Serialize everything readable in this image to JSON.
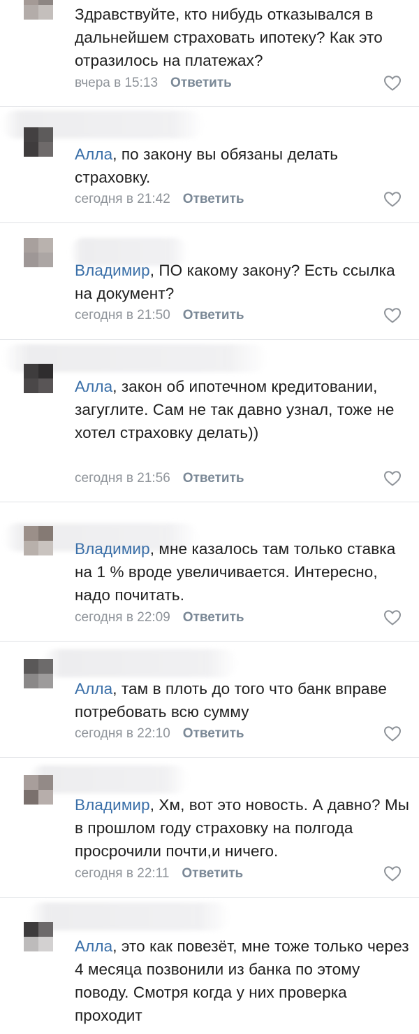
{
  "comments": [
    {
      "mention": "",
      "text": "Здравствуйте, кто нибудь отказывался в дальнейшем страховать ипотеку? Как это отразилось на платежах?",
      "time": "вчера в 15:13",
      "reply_label": "Ответить",
      "like_icon": "heart-outline-icon"
    },
    {
      "mention": "Алла",
      "text": ", по закону вы обязаны делать страховку.",
      "time": "сегодня в 21:42",
      "reply_label": "Ответить",
      "like_icon": "heart-outline-icon"
    },
    {
      "mention": "Владимир",
      "text": ", ПО какому закону? Есть ссылка на документ?",
      "time": "сегодня в 21:50",
      "reply_label": "Ответить",
      "like_icon": "heart-outline-icon"
    },
    {
      "mention": "Алла",
      "text": ", закон об ипотечном кредитовании, загуглите. Сам не так давно узнал, тоже не хотел страховку делать))",
      "time": "сегодня в 21:56",
      "reply_label": "Ответить",
      "like_icon": "heart-outline-icon"
    },
    {
      "mention": "Владимир",
      "text": ", мне казалось там только ставка на 1 % вроде увеличивается. Интересно, надо почитать.",
      "time": "сегодня в 22:09",
      "reply_label": "Ответить",
      "like_icon": "heart-outline-icon"
    },
    {
      "mention": "Алла",
      "text": ", там в плоть до того что банк вправе потребовать всю сумму",
      "time": "сегодня в 22:10",
      "reply_label": "Ответить",
      "like_icon": "heart-outline-icon"
    },
    {
      "mention": "Владимир",
      "text": ", Хм, вот это новость. А давно? Мы в прошлом году страховку на полгода просрочили почти,и ничего.",
      "time": "сегодня в 22:11",
      "reply_label": "Ответить",
      "like_icon": "heart-outline-icon"
    },
    {
      "mention": "Алла",
      "text": ", это как повезёт, мне тоже только через 4 месяца позвонили из банка по этому поводу. Смотря когда у них проверка проходит",
      "time": "",
      "reply_label": "",
      "like_icon": ""
    }
  ],
  "colors": {
    "mention": "#3a6fa8",
    "meta": "#8e9399",
    "reply": "#7a8896",
    "divider": "#dfe1e5"
  }
}
